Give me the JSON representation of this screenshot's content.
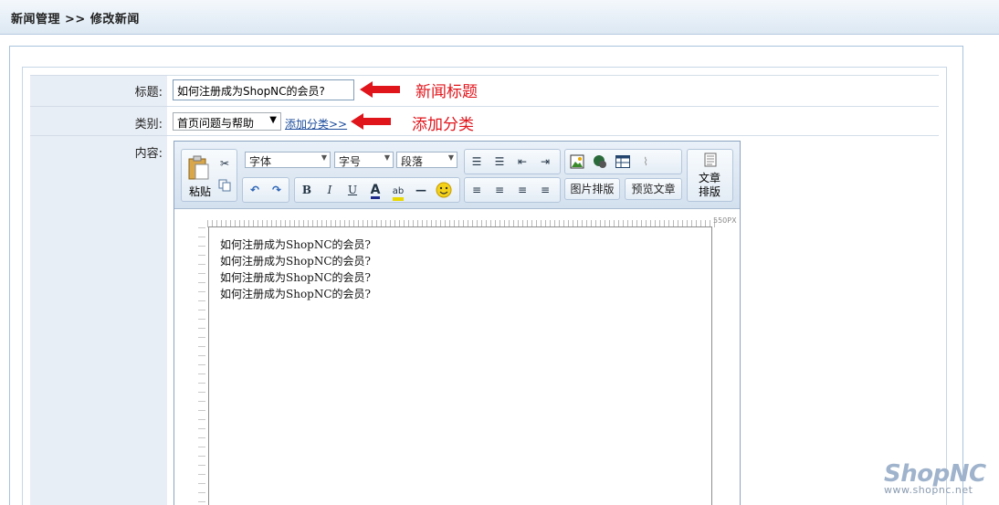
{
  "header": {
    "breadcrumb": "新闻管理 >> 修改新闻"
  },
  "form": {
    "title_label": "标题:",
    "title_value": "如何注册成为ShopNC的会员?",
    "category_label": "类别:",
    "category_value": "首页问题与帮助",
    "add_category_link": "添加分类>>",
    "content_label": "内容:"
  },
  "annotations": {
    "title_note": "新闻标题",
    "category_note": "添加分类"
  },
  "editor": {
    "paste_label": "粘贴",
    "font_combo": "字体",
    "size_combo": "字号",
    "paragraph_combo": "段落",
    "image_layout": "图片排版",
    "preview": "预览文章",
    "article_layout_line1": "文章",
    "article_layout_line2": "排版",
    "ruler_label": "550PX",
    "content_lines": [
      "如何注册成为ShopNC的会员?",
      "如何注册成为ShopNC的会员?",
      "如何注册成为ShopNC的会员?",
      "如何注册成为ShopNC的会员?"
    ]
  },
  "watermark": {
    "logo": "ShopNC",
    "url": "www.shopnc.net"
  },
  "colors": {
    "annotation": "#e0141b",
    "link": "#1c4d9c",
    "label_bg": "#e8eef5"
  },
  "icons": [
    "paste-icon",
    "cut-icon",
    "copy-icon",
    "undo-icon",
    "redo-icon",
    "ordered-list-icon",
    "unordered-list-icon",
    "outdent-icon",
    "indent-icon",
    "image-icon",
    "flash-icon",
    "table-icon",
    "attachment-icon",
    "smiley-icon",
    "article-layout-icon"
  ]
}
